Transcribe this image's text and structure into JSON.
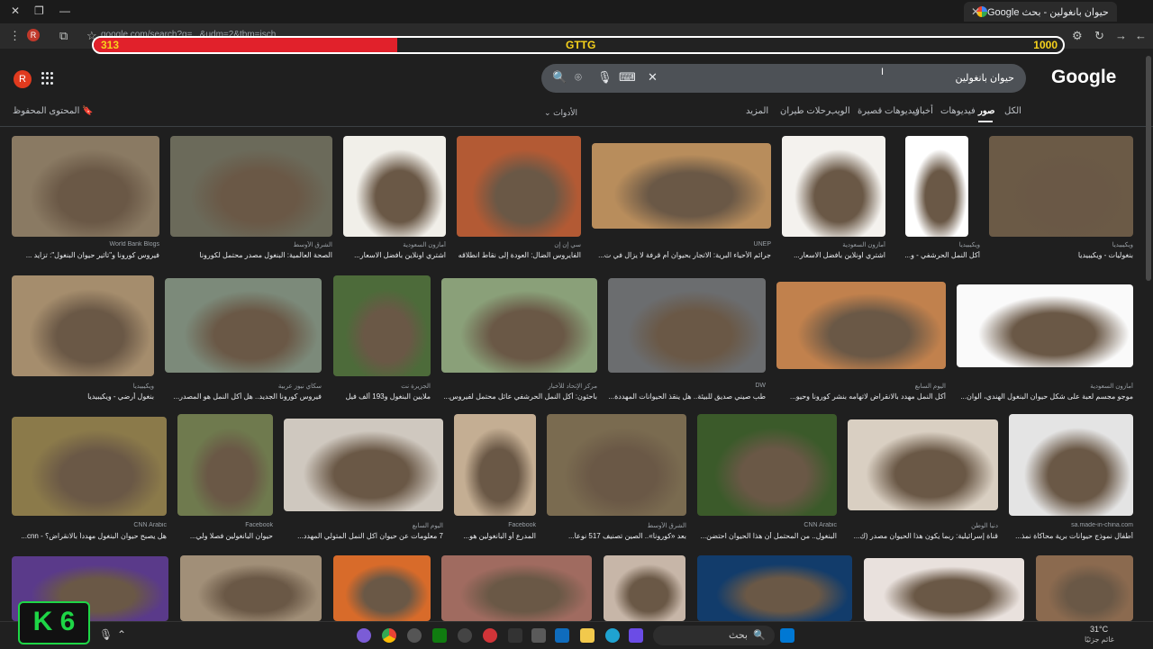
{
  "browser": {
    "tab_title": "حيوان بانغولين - بحث Google",
    "url": "google.com/search?q=...&udm=2&tbm=isch",
    "new_tab": "+",
    "close": "✕"
  },
  "overlay": {
    "left_value": "313",
    "center_label": "GTTG",
    "right_value": "1000",
    "progress_fraction": 0.313,
    "fill_color": "#e1212b",
    "text_color": "#f7d21b"
  },
  "google": {
    "logo": "Google",
    "avatar_letter": "R",
    "search_query": "حيوان بانغولين",
    "saved_label": "المحتوى المحفوظ",
    "tools_label": "الأدوات",
    "filters": [
      "الكل",
      "صور",
      "فيديوهات",
      "أخبار",
      "فيديوهات قصيرة",
      "الويب",
      "رحلات طيران",
      "المزيد"
    ]
  },
  "results": [
    {
      "src": "World Bank Blogs",
      "cap": "فيروس كورونا و\"تأثير حيوان البنغول\": تزايد ..."
    },
    {
      "src": "الشرق الأوسط",
      "cap": "الصحة العالمية: البنغول مصدر محتمل لكورونا"
    },
    {
      "src": "أمازون السعودية",
      "cap": "اشتري اونلاين بأفضل الاسعار..."
    },
    {
      "src": "سي إن إن",
      "cap": "الفايروس الضال: العودة إلى نقاط انطلاقه"
    },
    {
      "src": "UNEP",
      "cap": "جرائم الأحياء البرية: الاتجار بحيوان أم قرفة لا يزال في ت..."
    },
    {
      "src": "أمازون السعودية",
      "cap": "اشتري اونلاين بأفضل الاسعار..."
    },
    {
      "src": "ويكيبيديا",
      "cap": "أكل النمل الحرشفي - و..."
    },
    {
      "src": "ويكيبيديا",
      "cap": "بنغوليات - ويكيبيديا"
    },
    {
      "src": "ويكيبيديا",
      "cap": "بنغول أرضي - ويكيبيديا"
    },
    {
      "src": "سكاي نيوز عربية",
      "cap": "فيروس كورونا الجديد.. هل أكل النمل هو المصدر..."
    },
    {
      "src": "الجزيرة نت",
      "cap": "ملايين البنغول و193 ألف فيل"
    },
    {
      "src": "مركز الإتحاد للأخبار",
      "cap": "باحثون: أكل النمل الحرشفي عائل محتمل لفيروس..."
    },
    {
      "src": "DW",
      "cap": "طب صيني صديق للبيئة.. هل ينقذ الحيوانات المهددة..."
    },
    {
      "src": "اليوم السابع",
      "cap": "أكل النمل مهدد بالانقراض لاتهامه بنشر كورونا وحيو..."
    },
    {
      "src": "أمازون السعودية",
      "cap": "موجو مجسم لعبة على شكل حيوان البنغول الهندي، ألوان..."
    },
    {
      "src": "CNN Arabic",
      "cap": "هل يصبح حيوان البنغول مهدداً بالانقراض؟ - cnn..."
    },
    {
      "src": "Facebook",
      "cap": "حيوان البانغولين فصلا ولي..."
    },
    {
      "src": "اليوم السابع",
      "cap": "7 معلومات عن حيوان آكل النمل المتولي المهدد..."
    },
    {
      "src": "Facebook",
      "cap": "المدرع أو البانغولين هو..."
    },
    {
      "src": "الشرق الأوسط",
      "cap": "بعد «كورونا».. الصين تصنيف 517 نوعاً..."
    },
    {
      "src": "CNN Arabic",
      "cap": "البنغول.. من المحتمل أن هذا الحيوان احتضن..."
    },
    {
      "src": "دنيا الوطن",
      "cap": "قناة إسرائيلية: ربما يكون هذا الحيوان مصدر (ك..."
    },
    {
      "src": "sa.made-in-china.com",
      "cap": "أطفال نموذج حيوانات برية محاكاة نمذ..."
    }
  ],
  "taskbar": {
    "search_label": "بحث",
    "weather": "31°C",
    "weather_sub": "غائم جزئيًا"
  },
  "corner_badge": "K 6"
}
